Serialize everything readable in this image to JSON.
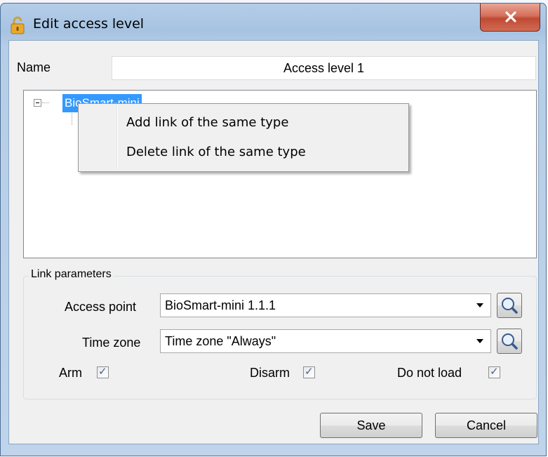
{
  "window": {
    "title": "Edit access level",
    "close_symbol": "x"
  },
  "name_field": {
    "label": "Name",
    "value": "Access level 1"
  },
  "tree": {
    "root_node": "BioSmart-mini",
    "expanded": true
  },
  "context_menu": {
    "items": [
      {
        "label": "Add link of the same type"
      },
      {
        "label": "Delete link of the same type"
      }
    ]
  },
  "link_parameters": {
    "legend": "Link parameters",
    "access_point": {
      "label": "Access point",
      "value": "BioSmart-mini 1.1.1"
    },
    "time_zone": {
      "label": "Time zone",
      "value": "Time zone \"Always\""
    },
    "checkboxes": [
      {
        "label": "Arm",
        "checked": true
      },
      {
        "label": "Disarm",
        "checked": true
      },
      {
        "label": "Do not load",
        "checked": true
      }
    ]
  },
  "buttons": {
    "save": "Save",
    "cancel": "Cancel"
  },
  "colors": {
    "selection": "#3399ff",
    "title_bar": "#b4cde8",
    "close_button": "#c9523e",
    "checkmark": "#4a5f97"
  },
  "icons": [
    "lock-icon",
    "close-icon",
    "search-icon",
    "dropdown-arrow-icon",
    "tree-collapse-icon",
    "checkmark-icon"
  ]
}
